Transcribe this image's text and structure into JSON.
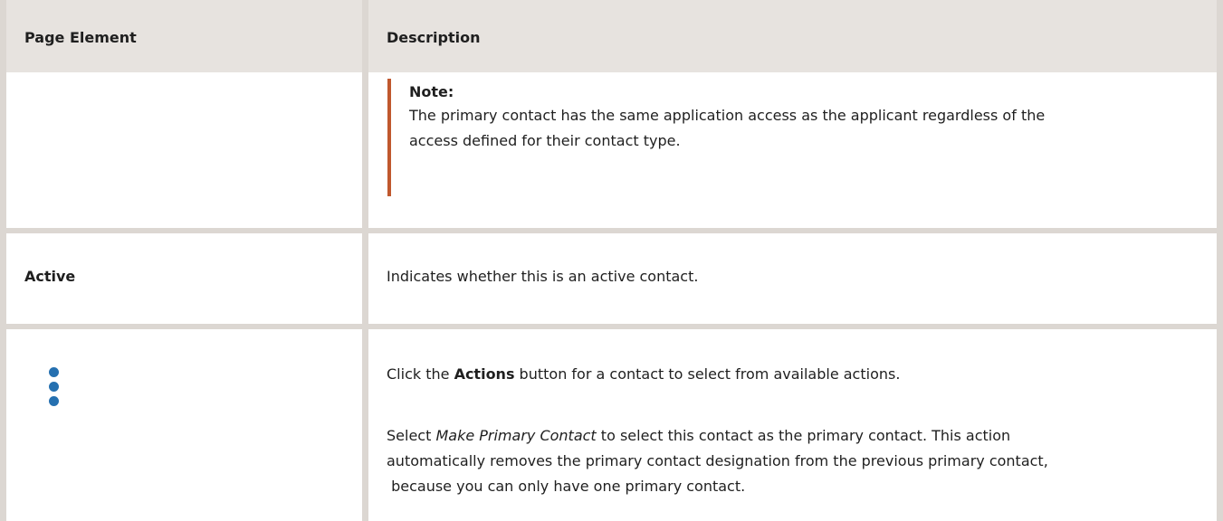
{
  "table": {
    "headers": [
      "Page Element",
      "Description"
    ],
    "rows": [
      {
        "element": "",
        "note": {
          "label": "Note:",
          "text_line1": "The primary contact has the same application access as the applicant regardless of the",
          "text_line2": "access defined for their contact type."
        }
      },
      {
        "element": "Active",
        "description": "Indicates whether this is an active contact."
      },
      {
        "element_icon": "vertical-ellipsis-icon",
        "desc1_prefix": "Click the ",
        "desc1_bold": "Actions",
        "desc1_suffix": " button for a contact to select from available actions.",
        "desc2_prefix": "Select ",
        "desc2_italic": "Make Primary Contact",
        "desc2_line1_suffix": " to select this contact as the primary contact. This action",
        "desc2_line2": "automatically removes the primary contact designation from the previous primary contact,",
        "desc2_line3": " because you can only have one primary contact."
      }
    ]
  },
  "colors": {
    "header_bg": "#e7e3df",
    "border": "#dcd7d2",
    "note_bar": "#c0582e",
    "icon_blue": "#2570b0"
  }
}
